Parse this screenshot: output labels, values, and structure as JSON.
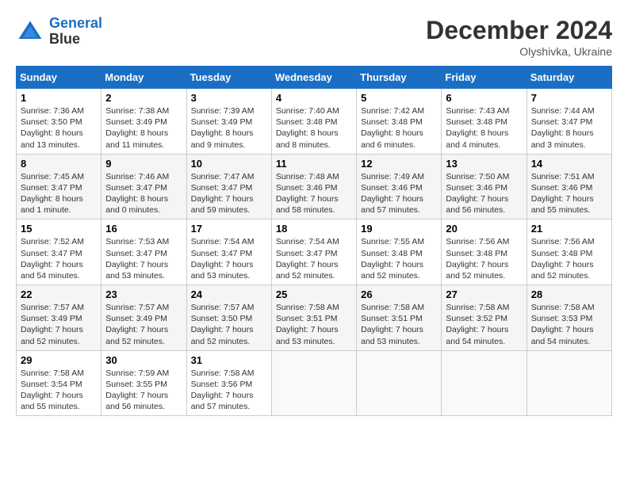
{
  "header": {
    "logo_line1": "General",
    "logo_line2": "Blue",
    "month": "December 2024",
    "location": "Olyshivka, Ukraine"
  },
  "weekdays": [
    "Sunday",
    "Monday",
    "Tuesday",
    "Wednesday",
    "Thursday",
    "Friday",
    "Saturday"
  ],
  "weeks": [
    [
      {
        "day": "1",
        "info": "Sunrise: 7:36 AM\nSunset: 3:50 PM\nDaylight: 8 hours\nand 13 minutes."
      },
      {
        "day": "2",
        "info": "Sunrise: 7:38 AM\nSunset: 3:49 PM\nDaylight: 8 hours\nand 11 minutes."
      },
      {
        "day": "3",
        "info": "Sunrise: 7:39 AM\nSunset: 3:49 PM\nDaylight: 8 hours\nand 9 minutes."
      },
      {
        "day": "4",
        "info": "Sunrise: 7:40 AM\nSunset: 3:48 PM\nDaylight: 8 hours\nand 8 minutes."
      },
      {
        "day": "5",
        "info": "Sunrise: 7:42 AM\nSunset: 3:48 PM\nDaylight: 8 hours\nand 6 minutes."
      },
      {
        "day": "6",
        "info": "Sunrise: 7:43 AM\nSunset: 3:48 PM\nDaylight: 8 hours\nand 4 minutes."
      },
      {
        "day": "7",
        "info": "Sunrise: 7:44 AM\nSunset: 3:47 PM\nDaylight: 8 hours\nand 3 minutes."
      }
    ],
    [
      {
        "day": "8",
        "info": "Sunrise: 7:45 AM\nSunset: 3:47 PM\nDaylight: 8 hours\nand 1 minute."
      },
      {
        "day": "9",
        "info": "Sunrise: 7:46 AM\nSunset: 3:47 PM\nDaylight: 8 hours\nand 0 minutes."
      },
      {
        "day": "10",
        "info": "Sunrise: 7:47 AM\nSunset: 3:47 PM\nDaylight: 7 hours\nand 59 minutes."
      },
      {
        "day": "11",
        "info": "Sunrise: 7:48 AM\nSunset: 3:46 PM\nDaylight: 7 hours\nand 58 minutes."
      },
      {
        "day": "12",
        "info": "Sunrise: 7:49 AM\nSunset: 3:46 PM\nDaylight: 7 hours\nand 57 minutes."
      },
      {
        "day": "13",
        "info": "Sunrise: 7:50 AM\nSunset: 3:46 PM\nDaylight: 7 hours\nand 56 minutes."
      },
      {
        "day": "14",
        "info": "Sunrise: 7:51 AM\nSunset: 3:46 PM\nDaylight: 7 hours\nand 55 minutes."
      }
    ],
    [
      {
        "day": "15",
        "info": "Sunrise: 7:52 AM\nSunset: 3:47 PM\nDaylight: 7 hours\nand 54 minutes."
      },
      {
        "day": "16",
        "info": "Sunrise: 7:53 AM\nSunset: 3:47 PM\nDaylight: 7 hours\nand 53 minutes."
      },
      {
        "day": "17",
        "info": "Sunrise: 7:54 AM\nSunset: 3:47 PM\nDaylight: 7 hours\nand 53 minutes."
      },
      {
        "day": "18",
        "info": "Sunrise: 7:54 AM\nSunset: 3:47 PM\nDaylight: 7 hours\nand 52 minutes."
      },
      {
        "day": "19",
        "info": "Sunrise: 7:55 AM\nSunset: 3:48 PM\nDaylight: 7 hours\nand 52 minutes."
      },
      {
        "day": "20",
        "info": "Sunrise: 7:56 AM\nSunset: 3:48 PM\nDaylight: 7 hours\nand 52 minutes."
      },
      {
        "day": "21",
        "info": "Sunrise: 7:56 AM\nSunset: 3:48 PM\nDaylight: 7 hours\nand 52 minutes."
      }
    ],
    [
      {
        "day": "22",
        "info": "Sunrise: 7:57 AM\nSunset: 3:49 PM\nDaylight: 7 hours\nand 52 minutes."
      },
      {
        "day": "23",
        "info": "Sunrise: 7:57 AM\nSunset: 3:49 PM\nDaylight: 7 hours\nand 52 minutes."
      },
      {
        "day": "24",
        "info": "Sunrise: 7:57 AM\nSunset: 3:50 PM\nDaylight: 7 hours\nand 52 minutes."
      },
      {
        "day": "25",
        "info": "Sunrise: 7:58 AM\nSunset: 3:51 PM\nDaylight: 7 hours\nand 53 minutes."
      },
      {
        "day": "26",
        "info": "Sunrise: 7:58 AM\nSunset: 3:51 PM\nDaylight: 7 hours\nand 53 minutes."
      },
      {
        "day": "27",
        "info": "Sunrise: 7:58 AM\nSunset: 3:52 PM\nDaylight: 7 hours\nand 54 minutes."
      },
      {
        "day": "28",
        "info": "Sunrise: 7:58 AM\nSunset: 3:53 PM\nDaylight: 7 hours\nand 54 minutes."
      }
    ],
    [
      {
        "day": "29",
        "info": "Sunrise: 7:58 AM\nSunset: 3:54 PM\nDaylight: 7 hours\nand 55 minutes."
      },
      {
        "day": "30",
        "info": "Sunrise: 7:59 AM\nSunset: 3:55 PM\nDaylight: 7 hours\nand 56 minutes."
      },
      {
        "day": "31",
        "info": "Sunrise: 7:58 AM\nSunset: 3:56 PM\nDaylight: 7 hours\nand 57 minutes."
      },
      null,
      null,
      null,
      null
    ]
  ]
}
